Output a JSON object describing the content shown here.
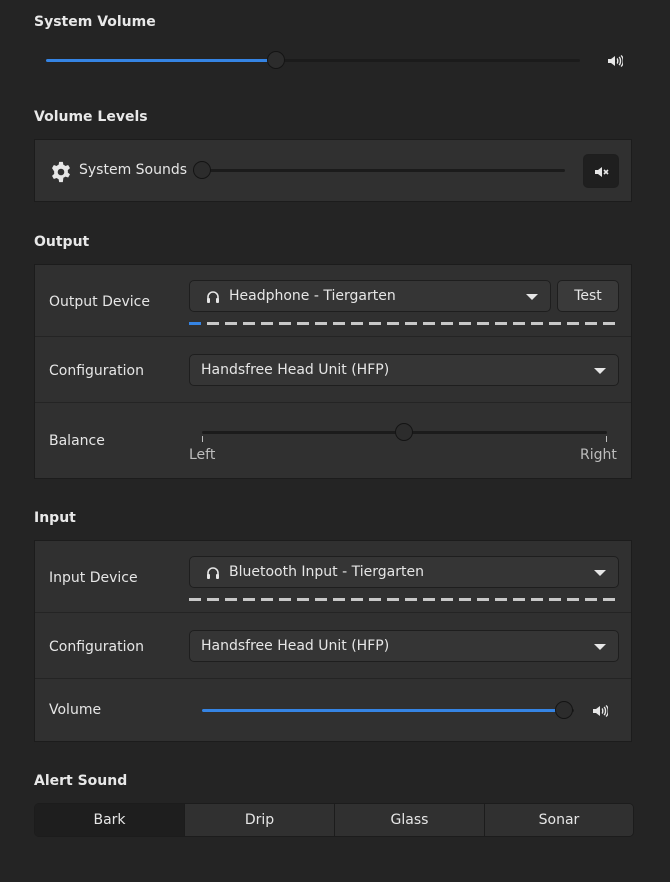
{
  "system_volume": {
    "heading": "System Volume",
    "level": 0.45,
    "icon": "speaker-high-icon"
  },
  "volume_levels": {
    "heading": "Volume Levels",
    "system_sounds_label": "System Sounds",
    "system_sounds_level": 0.0,
    "gear_icon": "gear-icon",
    "mute_icon": "speaker-muted-icon"
  },
  "output": {
    "heading": "Output",
    "device_label": "Output Device",
    "device_value": "Headphone - Tiergarten",
    "test_label": "Test",
    "config_label": "Configuration",
    "config_value": "Handsfree Head Unit (HFP)",
    "balance_label": "Balance",
    "balance_left": "Left",
    "balance_right": "Right",
    "balance_level": 0.5
  },
  "input": {
    "heading": "Input",
    "device_label": "Input Device",
    "device_value": "Bluetooth Input - Tiergarten",
    "config_label": "Configuration",
    "config_value": "Handsfree Head Unit (HFP)",
    "volume_label": "Volume",
    "volume_level": 1.0
  },
  "alert_sound": {
    "heading": "Alert Sound",
    "options": [
      "Bark",
      "Drip",
      "Glass",
      "Sonar"
    ],
    "selected": "Bark"
  },
  "colors": {
    "background": "#242424",
    "card": "#303030",
    "accent": "#3584e4"
  }
}
